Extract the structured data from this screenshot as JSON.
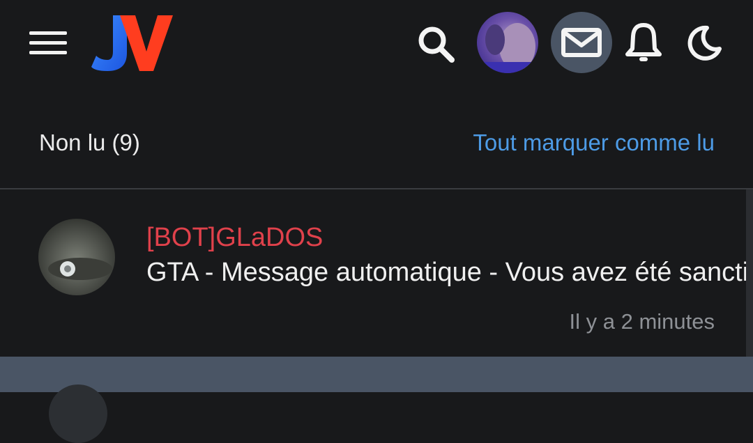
{
  "header": {
    "menu_icon": "hamburger-menu-icon",
    "logo_icon": "jv-logo",
    "search_icon": "search-icon",
    "mail_icon": "mail-icon",
    "bell_icon": "bell-icon",
    "theme_icon": "moon-icon",
    "colors": {
      "logo_blue": "#2a6ef2",
      "logo_red": "#ff3d1f",
      "mail_bg": "#4a5565"
    }
  },
  "notifications": {
    "unread_label": "Non lu (9)",
    "mark_all_label": "Tout marquer comme lu",
    "items": [
      {
        "sender": "[BOT]GLaDOS",
        "text": "GTA - Message automatique - Vous avez été sanctionné",
        "time": "Il y a 2 minutes"
      }
    ]
  },
  "colors": {
    "background": "#18191b",
    "link": "#4d9be6",
    "sender": "#e0414b",
    "muted": "#8e9196",
    "selected_row": "#4a5565"
  }
}
